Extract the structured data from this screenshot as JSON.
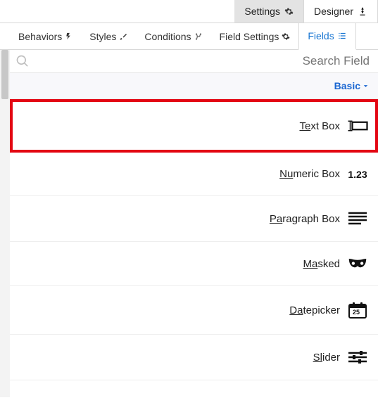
{
  "topbar": {
    "settings": "Settings",
    "designer": "Designer"
  },
  "subtabs": {
    "behaviors": "Behaviors",
    "styles": "Styles",
    "conditions": "Conditions",
    "field_settings": "Field Settings",
    "fields": "Fields"
  },
  "search": {
    "placeholder": "Search Field"
  },
  "group": {
    "basic": "Basic"
  },
  "fields": {
    "textbox_pre": "Te",
    "textbox_post": "xt Box",
    "numeric_pre": "Nu",
    "numeric_post": "meric Box",
    "numeric_sample": "1.23",
    "paragraph_pre": "Pa",
    "paragraph_post": "ragraph Box",
    "masked_pre": "Ma",
    "masked_post": "sked",
    "datepicker_pre": "Da",
    "datepicker_post": "tepicker",
    "datepicker_day": "25",
    "slider_pre": "Sl",
    "slider_post": "ider"
  }
}
